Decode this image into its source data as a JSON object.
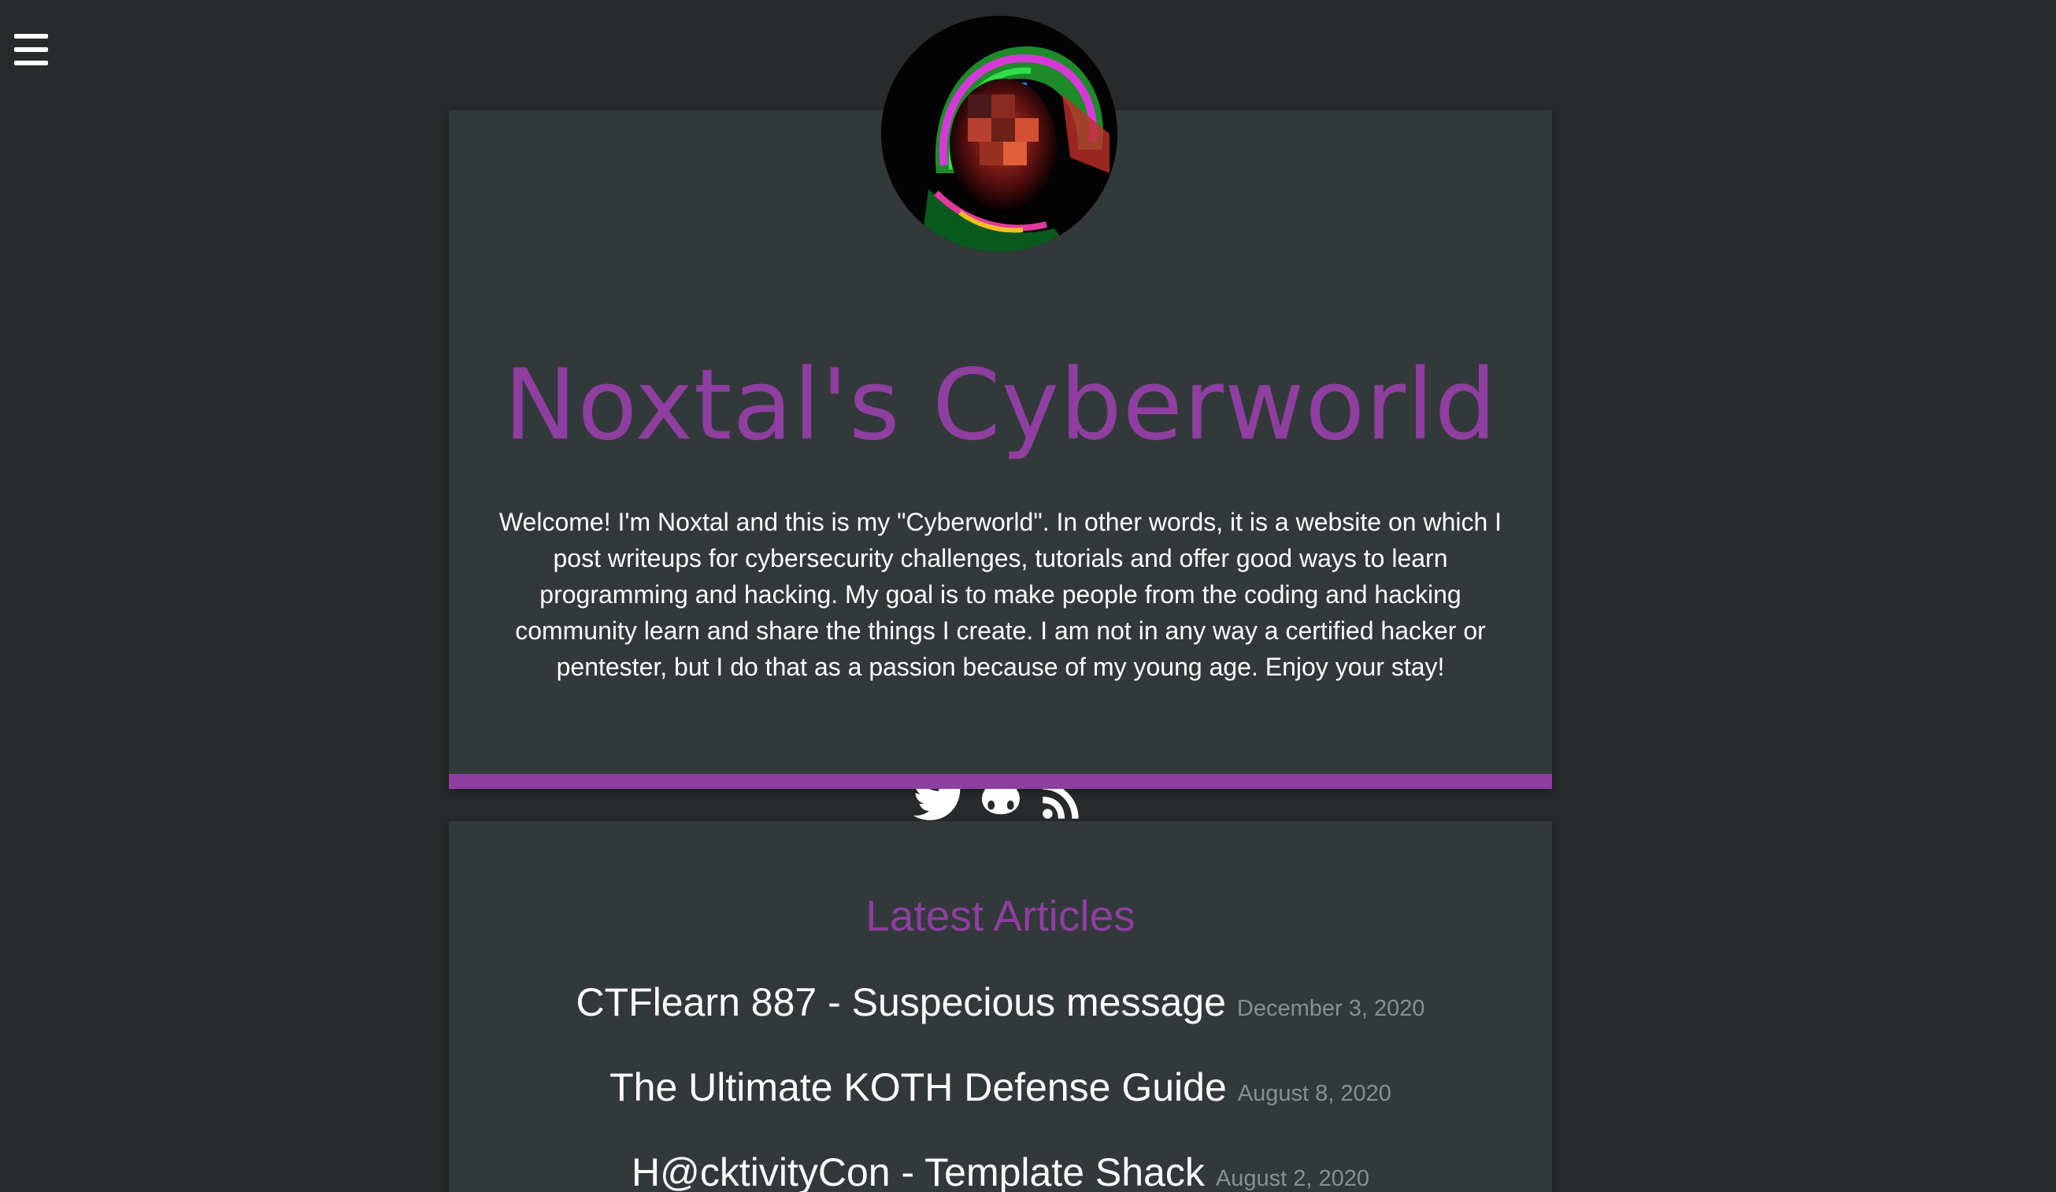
{
  "nav": {
    "menu_icon": "hamburger-menu-icon"
  },
  "hero": {
    "avatar_alt": "profile-avatar",
    "title": "Noxtal's Cyberworld",
    "intro": "Welcome! I'm Noxtal and this is my \"Cyberworld\". In other words, it is a website on which I post writeups for cybersecurity challenges, tutorials and offer good ways to learn programming and hacking. My goal is to make people from the coding and hacking community learn and share the things I create. I am not in any way a certified hacker or pentester, but I do that as a passion because of my young age. Enjoy your stay!",
    "socials": [
      {
        "icon": "twitter-icon"
      },
      {
        "icon": "github-icon"
      },
      {
        "icon": "rss-icon"
      }
    ]
  },
  "articles": {
    "heading": "Latest Articles",
    "items": [
      {
        "title": "CTFlearn 887 - Suspecious message",
        "date": "December 3, 2020"
      },
      {
        "title": "The Ultimate KOTH Defense Guide",
        "date": "August 8, 2020"
      },
      {
        "title": "H@cktivityCon - Template Shack",
        "date": "August 2, 2020"
      }
    ]
  },
  "colors": {
    "background": "#282b2c",
    "card": "#33393a",
    "accent": "#8e3fa0",
    "text": "#ffffff",
    "muted": "#8a8f90"
  }
}
